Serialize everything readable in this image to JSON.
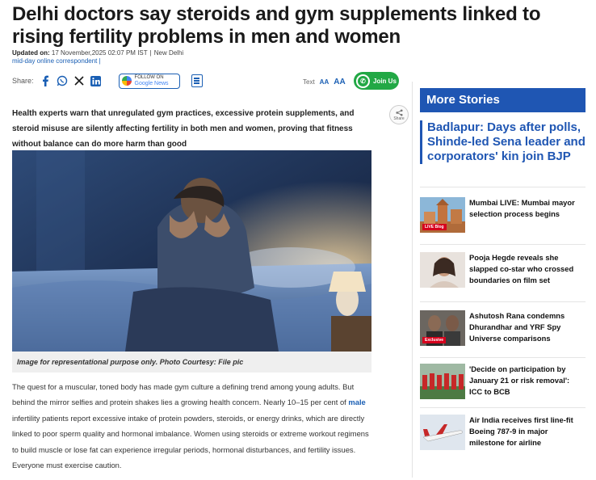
{
  "article": {
    "headline": "Delhi doctors say steroids and gym supplements linked to rising fertility problems in men and women",
    "updated_label": "Updated on:",
    "updated_value": "17 November,2025 02:07 PM IST",
    "location": "New Delhi",
    "author": "mid-day online correspondent",
    "share_label": "Share:",
    "text_label": "Text",
    "text_small": "AA",
    "text_large": "AA",
    "google_news_top": "FOLLOW ON",
    "google_news_bottom": "Google News",
    "join_label": "Join Us",
    "share_circle_label": "Share",
    "intro": "Health experts warn that unregulated gym practices, excessive protein supplements, and steroid misuse are silently affecting fertility in both men and women, proving that fitness without balance can do more harm than good",
    "image_caption": "Image for representational purpose only. Photo Courtesy: File pic",
    "body_part1": "The quest for a muscular, toned body has made gym culture a defining trend among young adults. But behind the mirror selfies and protein shakes lies a growing health concern. Nearly 10–15 per cent of ",
    "body_link": "male",
    "body_part2": " infertility patients report excessive intake of protein powders, steroids, or energy drinks, which are directly linked to poor sperm quality and hormonal imbalance. Women using steroids or extreme workout regimens to build muscle or lose fat can experience irregular periods, hormonal disturbances, and fertility issues. Everyone must exercise caution."
  },
  "sidebar": {
    "title": "More Stories",
    "lead_story": "Badlapur: Days after polls, Shinde-led Sena leader and corporators' kin join BJP",
    "stories": [
      {
        "title": "Mumbai LIVE: Mumbai mayor selection process begins",
        "tag": "LIVE Blog",
        "icon": "mumbai-skyline-thumbnail"
      },
      {
        "title": "Pooja Hegde reveals she slapped co-star who crossed boundaries on film set",
        "tag": "",
        "icon": "actress-portrait-thumbnail"
      },
      {
        "title": "Ashutosh Rana condemns Dhurandhar and YRF Spy Universe comparisons",
        "tag": "Exclusive",
        "icon": "actor-portrait-thumbnail"
      },
      {
        "title": "'Decide on participation by January 21 or risk removal': ICC to BCB",
        "tag": "",
        "icon": "cricket-team-thumbnail"
      },
      {
        "title": "Air India receives first line-fit Boeing 787-9 in major milestone for airline",
        "tag": "",
        "icon": "airplane-thumbnail"
      }
    ]
  },
  "colors": {
    "brand_blue": "#1f56b3",
    "join_green": "#22a845",
    "tag_red": "#d6001c"
  }
}
